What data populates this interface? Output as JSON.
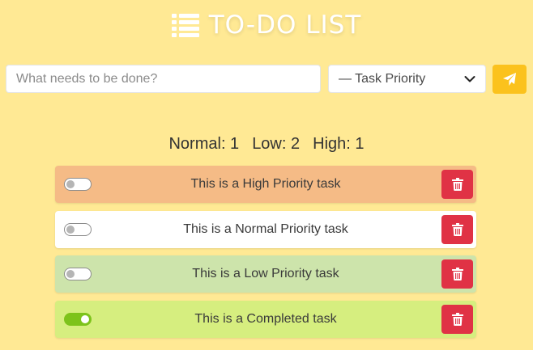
{
  "app": {
    "title": "TO-DO LIST",
    "logo_icon": "list-icon"
  },
  "form": {
    "input_placeholder": "What needs to be done?",
    "input_value": "",
    "priority_selected": "— Task Priority",
    "priority_icon": "chevron-down-icon",
    "submit_icon": "paper-plane-icon"
  },
  "stats": {
    "normal": "Normal: 1",
    "low": "Low: 2",
    "high": "High: 1"
  },
  "tasks": [
    {
      "text": "This is a High Priority task",
      "priority": "high",
      "completed": false,
      "color": "#f5bb86"
    },
    {
      "text": "This is a Normal Priority task",
      "priority": "normal",
      "completed": false,
      "color": "#ffffff"
    },
    {
      "text": "This is a Low Priority task",
      "priority": "low",
      "completed": false,
      "color": "#cde4ab"
    },
    {
      "text": "This is a Completed task",
      "priority": "completed",
      "completed": true,
      "color": "#d6ee7f"
    }
  ],
  "colors": {
    "background": "#ffe994",
    "accent": "#fbc21d",
    "delete": "#e03245",
    "toggle_on": "#7dc31b"
  },
  "icons": {
    "delete": "trash-icon"
  }
}
